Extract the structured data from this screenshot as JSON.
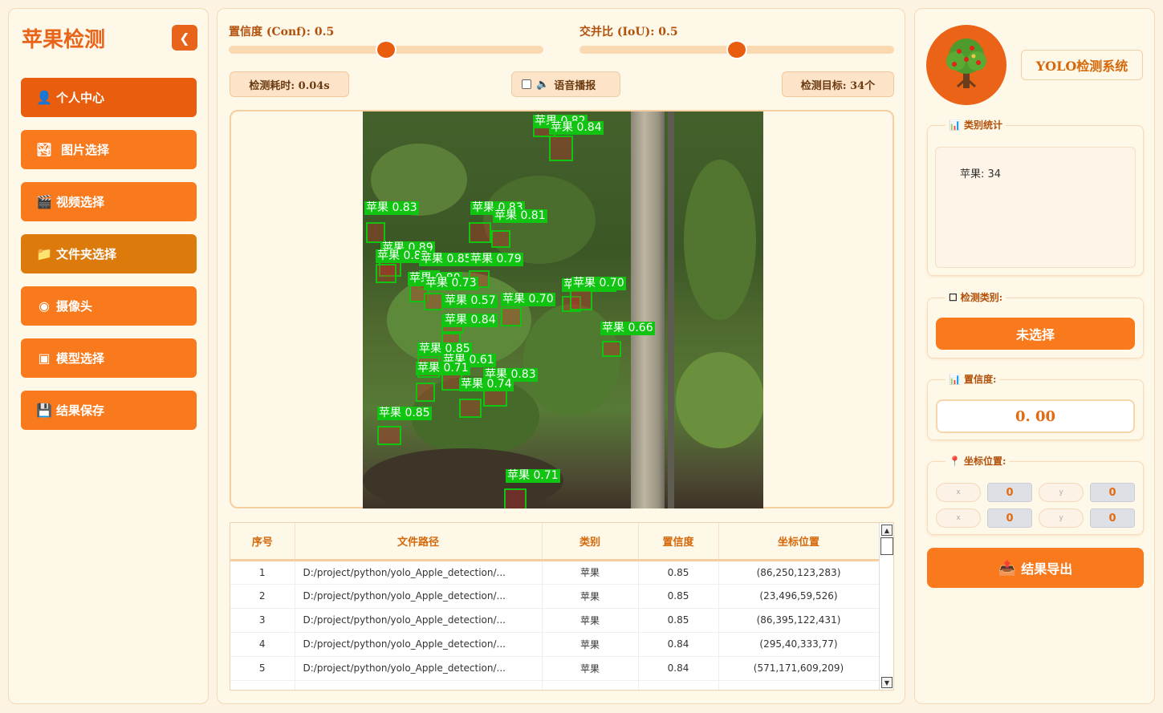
{
  "sidebar": {
    "title": "苹果检测",
    "collapse_icon": "chevron-left-icon",
    "items": [
      {
        "icon": "user-icon",
        "label": "个人中心"
      },
      {
        "icon": "image-icon",
        "label": "图片选择"
      },
      {
        "icon": "clapperboard-icon",
        "label": "视频选择"
      },
      {
        "icon": "folder-icon",
        "label": "文件夹选择"
      },
      {
        "icon": "camera-icon",
        "label": "摄像头"
      },
      {
        "icon": "model-icon",
        "label": "模型选择"
      },
      {
        "icon": "floppy-disk-icon",
        "label": "结果保存"
      }
    ]
  },
  "controls": {
    "conf_label": "置信度 (Conf): 0.5",
    "conf_value": 0.5,
    "iou_label": "交并比 (IoU): 0.5",
    "iou_value": 0.5,
    "time_label": "检测耗时: 0.04s",
    "voice_label": "语音播报",
    "voice_checked": false,
    "target_label": "检测目标: 34个"
  },
  "detections": [
    {
      "label": "苹果 0.82"
    },
    {
      "label": "苹果 0.84"
    },
    {
      "label": "苹果 0.83"
    },
    {
      "label": "苹果 0.83"
    },
    {
      "label": "苹果 0.81"
    },
    {
      "label": "苹果 0.89"
    },
    {
      "label": "苹果 0.82"
    },
    {
      "label": "苹果 0.85"
    },
    {
      "label": "苹果 0.79"
    },
    {
      "label": "苹果 0.80"
    },
    {
      "label": "苹果 0.73"
    },
    {
      "label": "苹果 0.57"
    },
    {
      "label": "苹果 0.84"
    },
    {
      "label": "苹果 0.70"
    },
    {
      "label": "苹果 0.79"
    },
    {
      "label": "苹果 0.70"
    },
    {
      "label": "苹果 0.66"
    },
    {
      "label": "苹果 0.85"
    },
    {
      "label": "苹果 0.61"
    },
    {
      "label": "苹果 0.71"
    },
    {
      "label": "苹果 0.83"
    },
    {
      "label": "苹果 0.74"
    },
    {
      "label": "苹果 0.85"
    },
    {
      "label": "苹果 0.71"
    }
  ],
  "table": {
    "headers": [
      "序号",
      "文件路径",
      "类别",
      "置信度",
      "坐标位置"
    ],
    "rows": [
      [
        "1",
        "D:/project/python/yolo_Apple_detection/...",
        "苹果",
        "0.85",
        "(86,250,123,283)"
      ],
      [
        "2",
        "D:/project/python/yolo_Apple_detection/...",
        "苹果",
        "0.85",
        "(23,496,59,526)"
      ],
      [
        "3",
        "D:/project/python/yolo_Apple_detection/...",
        "苹果",
        "0.85",
        "(86,395,122,431)"
      ],
      [
        "4",
        "D:/project/python/yolo_Apple_detection/...",
        "苹果",
        "0.84",
        "(295,40,333,77)"
      ],
      [
        "5",
        "D:/project/python/yolo_Apple_detection/...",
        "苹果",
        "0.84",
        "(571,171,609,209)"
      ]
    ]
  },
  "right": {
    "system_title": "YOLO检测系统",
    "stats_title": "类别统计",
    "stats_text": "苹果: 34",
    "class_title": "检测类别:",
    "class_button": "未选择",
    "conf_title": "置信度:",
    "conf_value": "0. 00",
    "coord_title": "坐标位置:",
    "coords": {
      "xmin_label": "x",
      "xmin": "0",
      "ymin_label": "y",
      "ymin": "0",
      "xmax_label": "x",
      "xmax": "0",
      "ymax_label": "y",
      "ymax": "0"
    },
    "export_label": "结果导出"
  },
  "colors": {
    "accent": "#f97a1c",
    "accent_dark": "#e85d0e",
    "box_green": "#12c412",
    "panel_bg": "#fef8e8"
  }
}
